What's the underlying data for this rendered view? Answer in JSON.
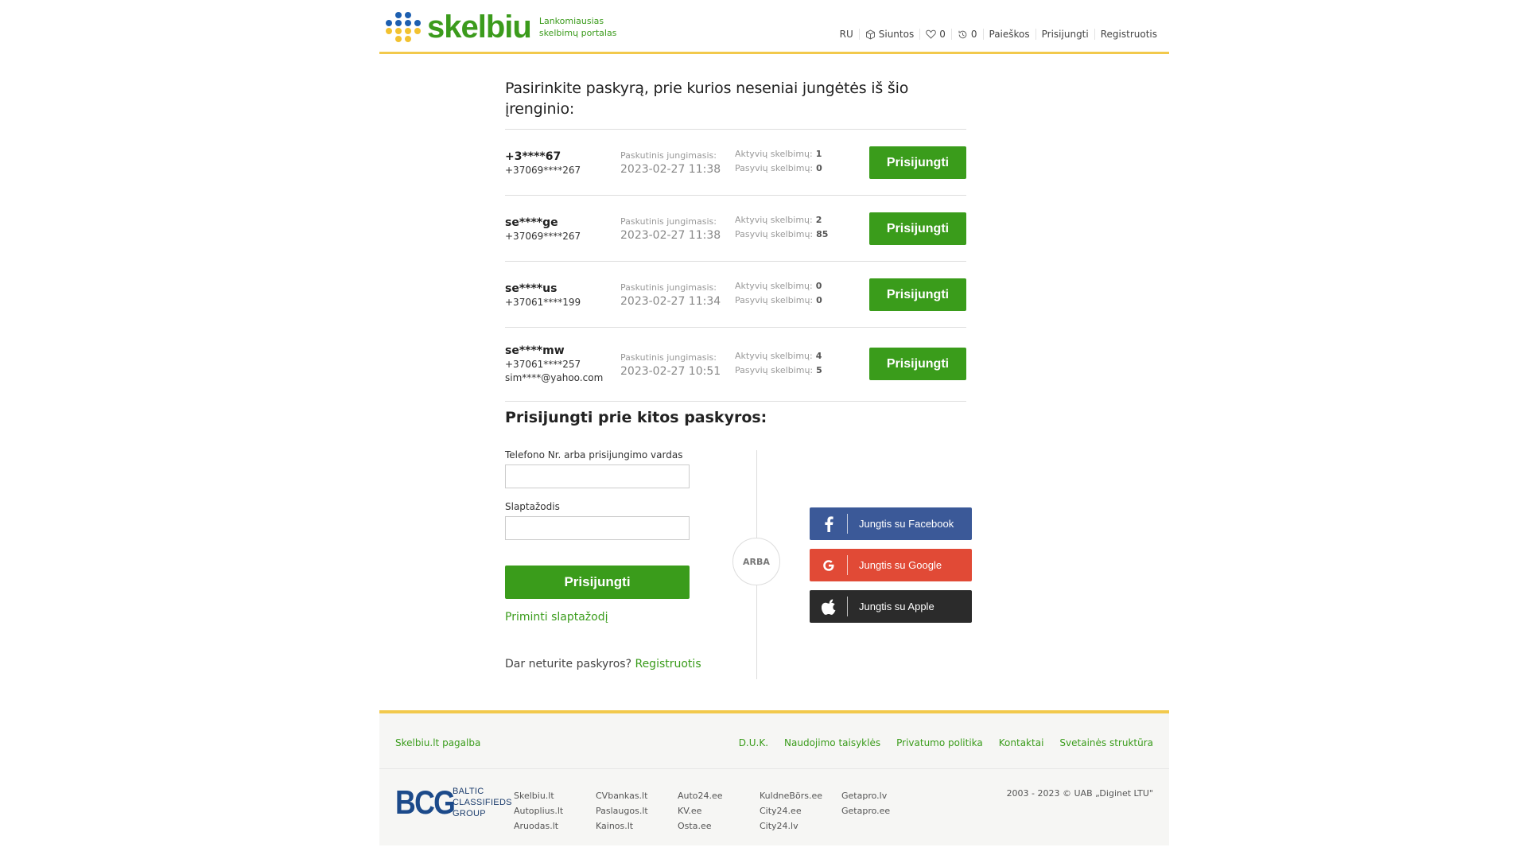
{
  "header": {
    "logo_word": "skelbiu",
    "tagline_line1": "Lankomiausias",
    "tagline_line2": "skelbimų portalas",
    "nav": {
      "lang": "RU",
      "shipments": "Siuntos",
      "favorites_count": "0",
      "history_count": "0",
      "searches": "Paieškos",
      "login": "Prisijungti",
      "register": "Registruotis"
    }
  },
  "recent": {
    "title": "Pasirinkite paskyrą, prie kurios neseniai jungėtės iš šio įrenginio:",
    "last_login_label": "Paskutinis jungimasis:",
    "active_label": "Aktyvių skelbimų:",
    "passive_label": "Pasyvių skelbimų:",
    "button_label": "Prisijungti",
    "accounts": [
      {
        "user": "+3****67",
        "phone": "+37069****267",
        "email": "",
        "last_login": "2023-02-27 11:38",
        "active": "1",
        "passive": "0"
      },
      {
        "user": "se****ge",
        "phone": "+37069****267",
        "email": "",
        "last_login": "2023-02-27 11:38",
        "active": "2",
        "passive": "85"
      },
      {
        "user": "se****us",
        "phone": "+37061****199",
        "email": "",
        "last_login": "2023-02-27 11:34",
        "active": "0",
        "passive": "0"
      },
      {
        "user": "se****mw",
        "phone": "+37061****257",
        "email": "sim****@yahoo.com",
        "last_login": "2023-02-27 10:51",
        "active": "4",
        "passive": "5"
      }
    ]
  },
  "other_login": {
    "title": "Prisijungti prie kitos paskyros:",
    "username_label": "Telefono Nr. arba prisijungimo vardas",
    "username_value": "",
    "password_label": "Slaptažodis",
    "password_value": "",
    "submit_label": "Prisijungti",
    "remind_label": "Priminti slaptažodį",
    "no_account_text": "Dar neturite paskyros?",
    "register_link": "Registruotis",
    "or_label": "ARBA",
    "social": {
      "facebook": "Jungtis su Facebook",
      "google": "Jungtis su Google",
      "apple": "Jungtis su Apple"
    }
  },
  "footer": {
    "help": "Skelbiu.lt pagalba",
    "links": [
      "D.U.K.",
      "Naudojimo taisyklės",
      "Privatumo politika",
      "Kontaktai",
      "Svetainės struktūra"
    ],
    "bcg_mark": "BCG",
    "bcg_line1": "BALTIC",
    "bcg_line2": "CLASSIFIEDS",
    "bcg_line3": "GROUP",
    "sites": [
      [
        "Skelbiu.lt",
        "Autoplius.lt",
        "Aruodas.lt"
      ],
      [
        "CVbankas.lt",
        "Paslaugos.lt",
        "Kainos.lt"
      ],
      [
        "Auto24.ee",
        "KV.ee",
        "Osta.ee"
      ],
      [
        "KuldneBörs.ee",
        "City24.ee",
        "City24.lv"
      ],
      [
        "Getapro.lv",
        "Getapro.ee"
      ]
    ],
    "copyright": "2003 - 2023 © UAB „Diginet LTU\""
  },
  "colors": {
    "brand_green": "#3a9c1b",
    "accent_yellow": "#f2c94c",
    "facebook": "#3b5998",
    "google": "#e14a36",
    "apple": "#2b2b2b"
  }
}
